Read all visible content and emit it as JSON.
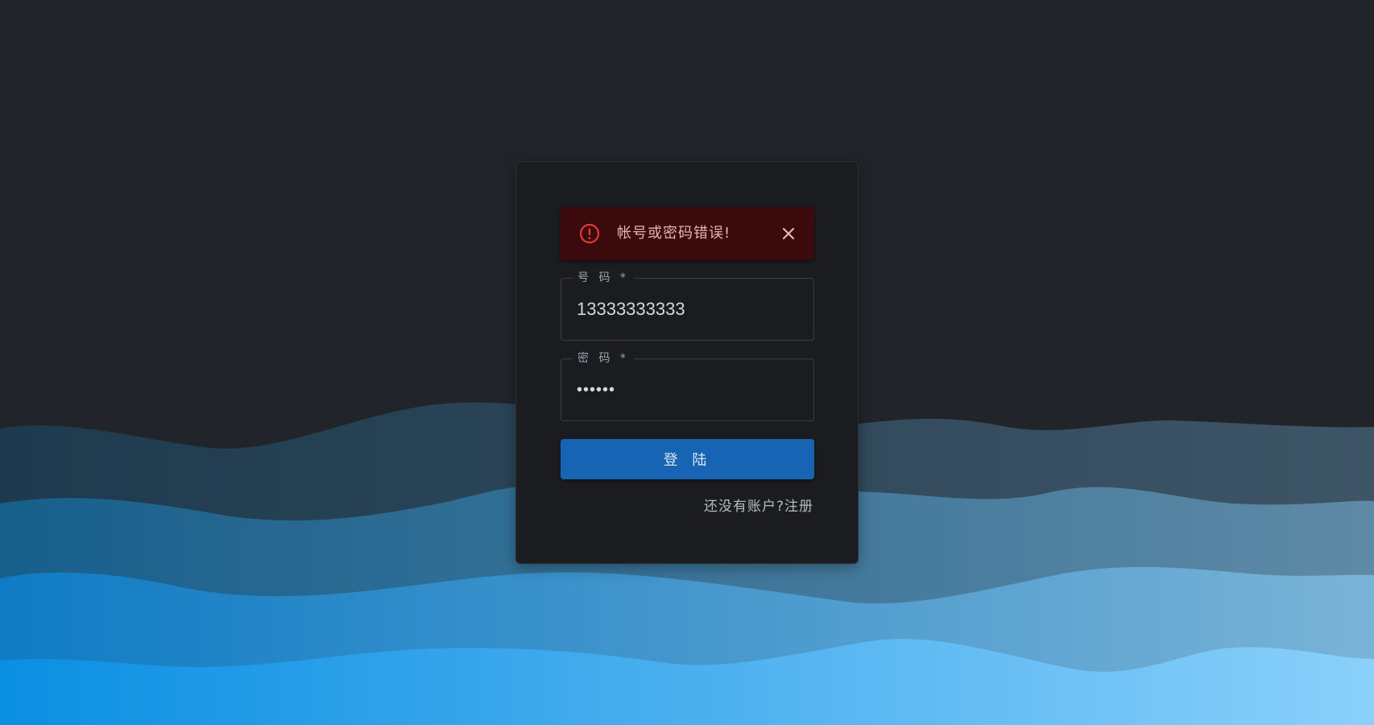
{
  "alert": {
    "icon": "error-circle-icon",
    "message": "帐号或密码错误!",
    "close_icon": "close-icon",
    "background": "#3b0a0c",
    "accent": "#e53935"
  },
  "form": {
    "phone": {
      "label": "号 码 *",
      "value": "13333333333"
    },
    "password": {
      "label": "密 码 *",
      "value": "••••••"
    },
    "submit_label": "登 陆",
    "register_link": "还没有账户?注册"
  },
  "colors": {
    "page_background": "#212529",
    "card_background": "#1a1c1f",
    "primary": "#1763b4"
  }
}
